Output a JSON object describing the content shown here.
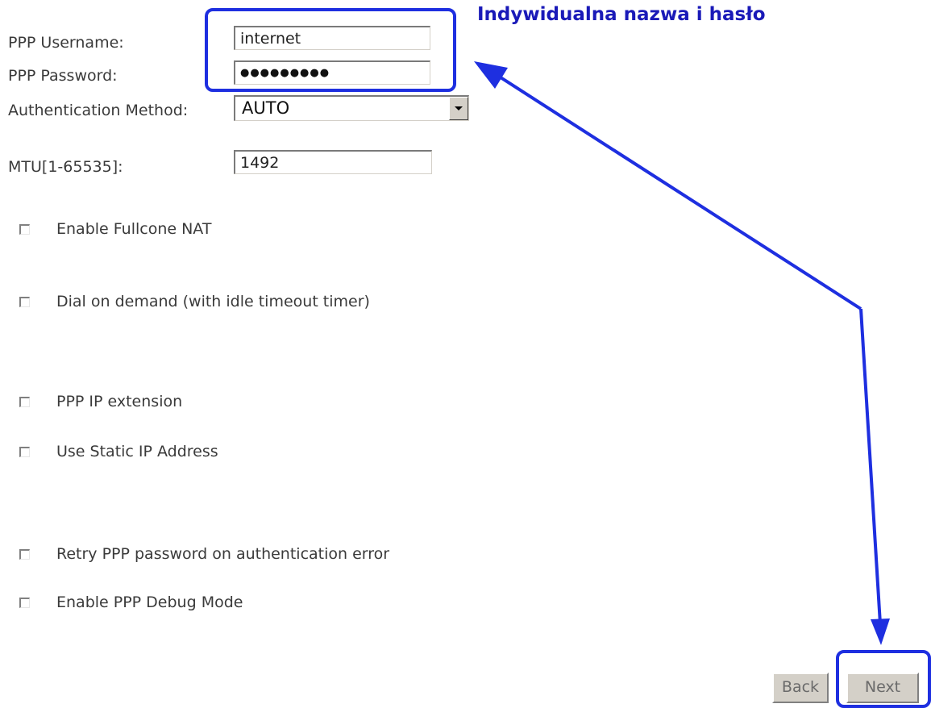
{
  "form": {
    "username": {
      "label": "PPP Username:",
      "value": "internet"
    },
    "password": {
      "label": "PPP Password:",
      "masked_value": "●●●●●●●●●"
    },
    "auth": {
      "label": "Authentication Method:",
      "selected": "AUTO"
    },
    "mtu": {
      "label": "MTU[1-65535]:",
      "value": "1492"
    },
    "options": [
      {
        "label": "Enable Fullcone NAT",
        "checked": false
      },
      {
        "label": "Dial on demand (with idle timeout timer)",
        "checked": false
      },
      {
        "label": "PPP IP extension",
        "checked": false
      },
      {
        "label": "Use Static IP Address",
        "checked": false
      },
      {
        "label": "Retry PPP password on authentication error",
        "checked": false
      },
      {
        "label": "Enable PPP Debug Mode",
        "checked": false
      }
    ]
  },
  "buttons": {
    "back_label": "Back",
    "next_label": "Next"
  },
  "annotation": {
    "title": "Indywidualna nazwa i hasło",
    "color": "#1e2fe0"
  }
}
